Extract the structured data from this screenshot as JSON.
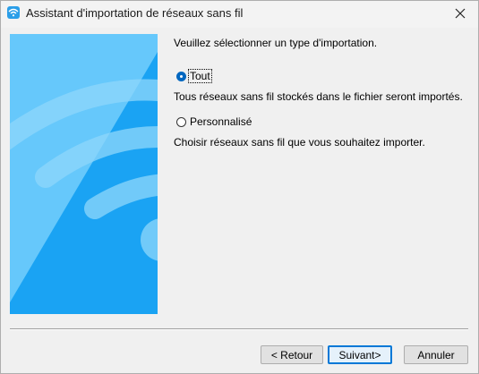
{
  "window": {
    "title": "Assistant d'importation de réseaux sans fil",
    "app_icon": "wifi-app-icon",
    "close_icon": "close-icon"
  },
  "banner": {
    "icon": "wifi-signal-illustration",
    "colors": {
      "background": "#1aa3f3",
      "light": "#66c8fb",
      "arc": "#8fd7fb"
    }
  },
  "content": {
    "prompt": "Veuillez sélectionner un type d'importation.",
    "options": [
      {
        "label": "Tout",
        "checked": true,
        "description": "Tous réseaux sans fil stockés dans le fichier seront importés."
      },
      {
        "label": "Personnalisé",
        "checked": false,
        "description": "Choisir réseaux sans fil que vous souhaitez importer."
      }
    ]
  },
  "buttons": {
    "back": "< Retour",
    "next": "Suivant>",
    "cancel": "Annuler"
  }
}
